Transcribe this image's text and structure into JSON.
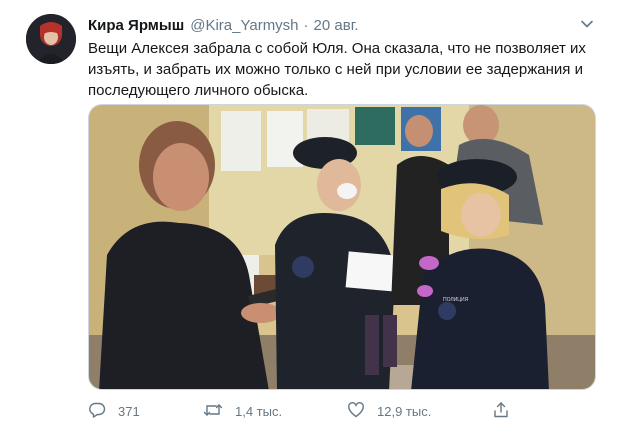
{
  "tweet": {
    "author_name": "Кира Ярмыш",
    "author_handle": "@Kira_Yarmysh",
    "separator": "·",
    "date": "20 авг.",
    "text": "Вещи Алексея забрала с собой Юля. Она сказала, что не позволяет их изъять, и забрать их можно только с ней при условии ее задержания и последующего личного обыска.",
    "image_label": "ПОЛИЦИЯ"
  },
  "actions": {
    "reply_count": "371",
    "retweet_count": "1,4 тыс.",
    "like_count": "12,9 тыс.",
    "share_icon": "share-icon"
  },
  "colors": {
    "text_primary": "#14171a",
    "text_secondary": "#657786",
    "border": "#ccd6dd"
  }
}
